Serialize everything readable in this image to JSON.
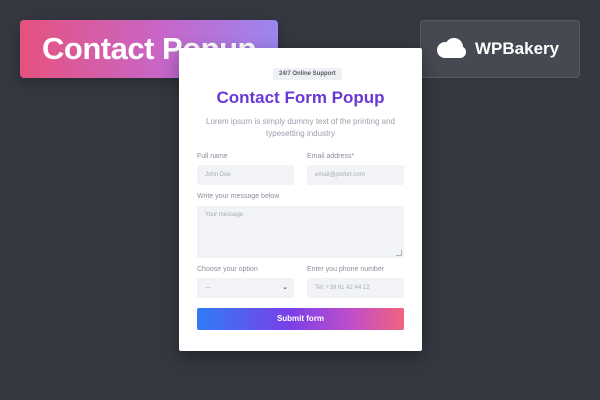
{
  "banner": {
    "text": "Contact Popup"
  },
  "brand": {
    "name": "WPBakery",
    "logo_icon": "cloud-logo-icon"
  },
  "popup": {
    "badge": "24/7 Online Support",
    "title": "Contact Form Popup",
    "subtitle": "Lorem ipsum is simply dummy text of the printing and typesetting industry",
    "fields": {
      "full_name": {
        "label": "Full name",
        "placeholder": "John Doe"
      },
      "email": {
        "label": "Email address*",
        "placeholder": "email@pixfort.com"
      },
      "message": {
        "label": "Write your message below",
        "placeholder": "Your message"
      },
      "option": {
        "label": "Choose your option",
        "value": "—"
      },
      "phone": {
        "label": "Enter you phone number",
        "placeholder": "Tel: +39 61 42 44 12"
      }
    },
    "submit_label": "Submit form"
  },
  "colors": {
    "background": "#353841",
    "title": "#6a38d4",
    "banner_gradient": [
      "#e6527e",
      "#9b86f0"
    ],
    "button_gradient": [
      "#2f7cf6",
      "#f0627e"
    ]
  }
}
